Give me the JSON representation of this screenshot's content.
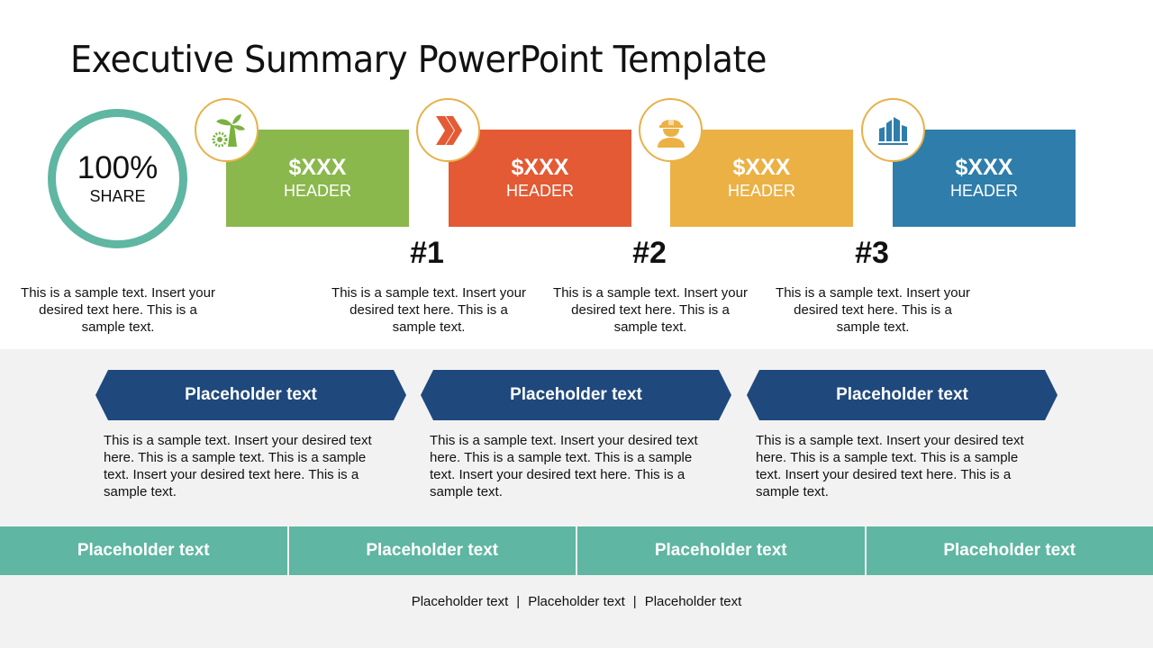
{
  "title": "Executive Summary PowerPoint Template",
  "share": {
    "value": "100%",
    "label": "SHARE"
  },
  "cards": [
    {
      "value": "$XXX",
      "header": "HEADER",
      "color": "#8ab84c",
      "icon": "wind-turbine-gear-icon"
    },
    {
      "value": "$XXX",
      "header": "HEADER",
      "color": "#e35a34",
      "icon": "double-chevron-right-icon"
    },
    {
      "value": "$XXX",
      "header": "HEADER",
      "color": "#ebb145",
      "icon": "worker-hardhat-icon"
    },
    {
      "value": "$XXX",
      "header": "HEADER",
      "color": "#2e7dab",
      "icon": "buildings-icon"
    }
  ],
  "ranks": [
    "#1",
    "#2",
    "#3"
  ],
  "sample_texts": [
    "This is a sample text. Insert your desired text here. This is a sample text.",
    "This is a sample text. Insert your desired text here. This is a sample text.",
    "This is a sample text. Insert your desired text here. This is a sample text.",
    "This is a sample text. Insert your desired text here. This is a sample text."
  ],
  "sections": [
    {
      "title": "Placeholder text",
      "body": "This is a sample text. Insert your desired text here. This is a sample text. This is a sample text. Insert your desired text here. This is a sample text."
    },
    {
      "title": "Placeholder text",
      "body": "This is a sample text. Insert your desired text here. This is a sample text. This is a sample text. Insert your desired text here. This is a sample text."
    },
    {
      "title": "Placeholder text",
      "body": "This is a sample text. Insert your desired text here. This is a sample text. This is a sample text. Insert your desired text here. This is a sample text."
    }
  ],
  "tabs": [
    "Placeholder text",
    "Placeholder text",
    "Placeholder text",
    "Placeholder text"
  ],
  "footer": {
    "items": [
      "Placeholder text",
      "Placeholder text",
      "Placeholder text"
    ],
    "separator": "|"
  }
}
